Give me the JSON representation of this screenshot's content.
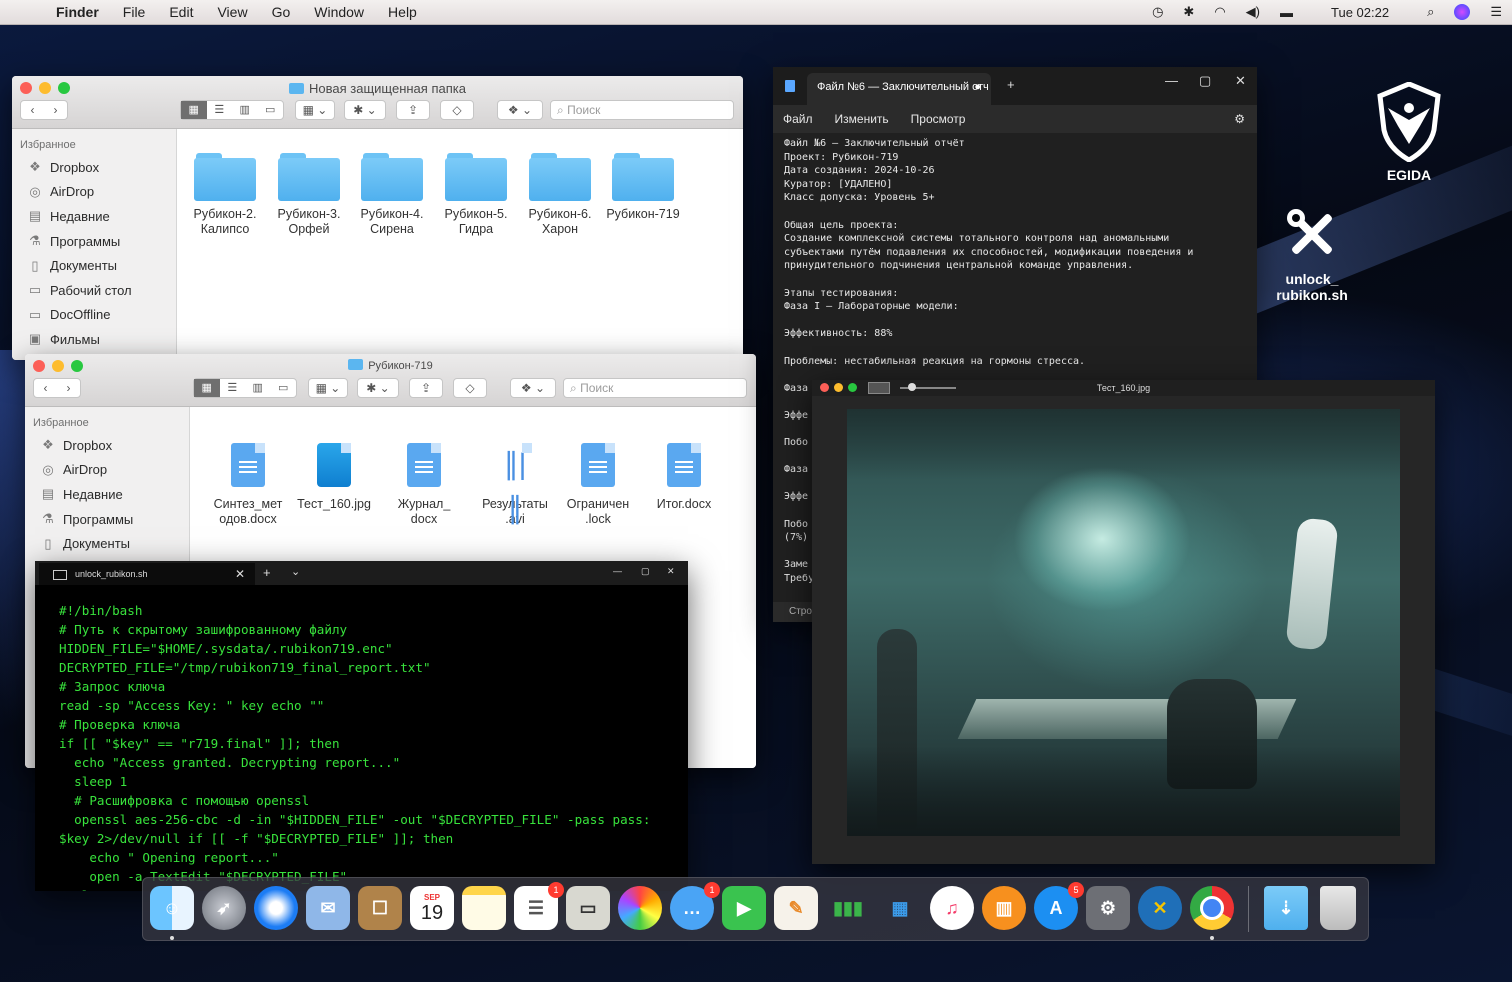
{
  "menubar": {
    "app": "Finder",
    "items": [
      "File",
      "Edit",
      "View",
      "Go",
      "Window",
      "Help"
    ],
    "clock": "Tue 02:22"
  },
  "desktop": {
    "egida_label": "EGIDA",
    "script_label_1": "unlock_",
    "script_label_2": "rubikon.sh"
  },
  "finder1": {
    "title": "Новая защищенная папка",
    "search_placeholder": "Поиск",
    "sidebar_header": "Избранное",
    "sidebar": [
      "Dropbox",
      "AirDrop",
      "Недавние",
      "Программы",
      "Документы",
      "Рабочий стол",
      "DocOffline",
      "Фильмы"
    ],
    "items": [
      {
        "l1": "Рубикон-2.",
        "l2": "Калипсо"
      },
      {
        "l1": "Рубикон-3.",
        "l2": "Орфей"
      },
      {
        "l1": "Рубикон-4.",
        "l2": "Сирена"
      },
      {
        "l1": "Рубикон-5.",
        "l2": "Гидра"
      },
      {
        "l1": "Рубикон-6.",
        "l2": "Харон"
      },
      {
        "l1": "Рубикон-719",
        "l2": ""
      }
    ]
  },
  "finder2": {
    "title": "Рубикон-719",
    "search_placeholder": "Поиск",
    "sidebar_header": "Избранное",
    "sidebar": [
      "Dropbox",
      "AirDrop",
      "Недавние",
      "Программы",
      "Документы"
    ],
    "items": [
      {
        "l1": "Синтез_мет",
        "l2": "одов.docx"
      },
      {
        "l1": "Тест_160.jpg",
        "l2": ""
      },
      {
        "l1": "Журнал_",
        "l2": "docx"
      },
      {
        "l1": "Результаты",
        "l2": ".avi"
      },
      {
        "l1": "Ограничен",
        "l2": ".lock"
      },
      {
        "l1": "Итог.docx",
        "l2": ""
      }
    ]
  },
  "notepad": {
    "tab_title": "Файл №6 — Заключительный отч",
    "menu": [
      "Файл",
      "Изменить",
      "Просмотр"
    ],
    "body": "Файл №6 — Заключительный отчёт\nПроект: Рубикон-719\nДата создания: 2024-10-26\nКуратор: [УДАЛЕНО]\nКласс допуска: Уровень 5+\n\nОбщая цель проекта:\nСоздание комплексной системы тотального контроля над аномальными\nсубъектами путём подавления их способностей, модификации поведения и\nпринудительного подчинения центральной команде управления.\n\nЭтапы тестирования:\nФаза I — Лабораторные модели:\n\nЭффективность: 88%\n\nПроблемы: нестабильная реакция на гормоны стресса.\n\nФаза\n\nЭффе\n\nПобо\n\nФаза\n\nЭффе\n\nПобо\n(7%)\n\nЗаме\nТребу",
    "status": "Стро"
  },
  "viewer": {
    "title": "Тест_160.jpg"
  },
  "terminal": {
    "tab_title": "unlock_rubikon.sh",
    "code": "#!/bin/bash\n# Путь к скрытому зашифрованному файлу\nHIDDEN_FILE=\"$HOME/.sysdata/.rubikon719.enc\"\nDECRYPTED_FILE=\"/tmp/rubikon719_final_report.txt\"\n# Запрос ключа\nread -sp \"Access Key: \" key echo \"\"\n# Проверка ключа\nif [[ \"$key\" == \"r719.final\" ]]; then\n  echo \"Access granted. Decrypting report...\"\n  sleep 1\n  # Расшифровка с помощью openssl\n  openssl aes-256-cbc -d -in \"$HIDDEN_FILE\" -out \"$DECRYPTED_FILE\" -pass pass:\n$key 2>/dev/null if [[ -f \"$DECRYPTED_FILE\" ]]; then\n    echo \" Opening report...\"\n    open -a TextEdit \"$DECRYPTED_FILE\"\n  else"
  },
  "dock": {
    "calendar_month": "SEP",
    "calendar_day": "19",
    "badges": {
      "reminders": "1",
      "messages": "1",
      "appstore": "5"
    }
  }
}
